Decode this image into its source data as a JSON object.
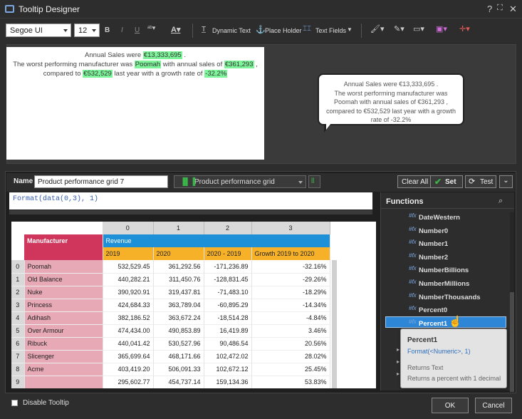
{
  "window": {
    "title": "Tooltip Designer",
    "help": "?",
    "maximize": "⛶",
    "close": "✕"
  },
  "toolbar": {
    "font": "Segoe UI",
    "size": "12",
    "bold": "B",
    "italic": "I",
    "underline": "U",
    "dynamic_text": "Dynamic Text",
    "place_holder": "Place Holder",
    "text_fields": "Text Fields"
  },
  "editor": {
    "line1_pre": "Annual Sales were ",
    "line1_val": "€13,333,695",
    "line1_post": " .",
    "line2_pre": "The worst performing manufacturer was ",
    "line2_name": "Poomah",
    "line2_mid": " with annual sales of ",
    "line2_val": "€361,293",
    "line2_post": " ,",
    "line3_pre": "compared to ",
    "line3_val": "€532,529",
    "line3_mid": " last year with a growth rate of ",
    "line3_rate": "-32.2%"
  },
  "bubble": {
    "line1": "Annual Sales were €13,333,695 .",
    "line2": "The worst performing manufacturer was",
    "line3": "Poomah  with annual sales of €361,293 ,",
    "line4": "compared to €532,529  last year with a growth",
    "line5": "rate of -32.2%"
  },
  "namebar": {
    "label": "Name",
    "name_value": "Product performance grid 7",
    "grid": "Product performance grid",
    "clear_all": "Clear All",
    "set": "Set",
    "test": "Test"
  },
  "formula": "Format(data(0,3), 1)",
  "grid": {
    "col_indices": [
      "0",
      "1",
      "2",
      "3"
    ],
    "manufacturer_header": "Manufacturer",
    "measure_header": "Revenue",
    "sub_headers": [
      "2019",
      "2020",
      "2020 - 2019",
      "Growth 2019 to 2020"
    ],
    "rows": [
      {
        "i": "0",
        "name": "Poomah",
        "v": [
          "532,529.45",
          "361,292.56",
          "-171,236.89",
          "-32.16%"
        ]
      },
      {
        "i": "1",
        "name": "Old Balance",
        "v": [
          "440,282.21",
          "311,450.76",
          "-128,831.45",
          "-29.26%"
        ]
      },
      {
        "i": "2",
        "name": "Nuke",
        "v": [
          "390,920.91",
          "319,437.81",
          "-71,483.10",
          "-18.29%"
        ]
      },
      {
        "i": "3",
        "name": "Princess",
        "v": [
          "424,684.33",
          "363,789.04",
          "-60,895.29",
          "-14.34%"
        ]
      },
      {
        "i": "4",
        "name": "Adihash",
        "v": [
          "382,186.52",
          "363,672.24",
          "-18,514.28",
          "-4.84%"
        ]
      },
      {
        "i": "5",
        "name": "Over Armour",
        "v": [
          "474,434.00",
          "490,853.89",
          "16,419.89",
          "3.46%"
        ]
      },
      {
        "i": "6",
        "name": "Ribuck",
        "v": [
          "440,041.42",
          "530,527.96",
          "90,486.54",
          "20.56%"
        ]
      },
      {
        "i": "7",
        "name": "Slicenger",
        "v": [
          "365,699.64",
          "468,171.66",
          "102,472.02",
          "28.02%"
        ]
      },
      {
        "i": "8",
        "name": "Acme",
        "v": [
          "403,419.20",
          "506,091.33",
          "102,672.12",
          "25.45%"
        ]
      },
      {
        "i": "9",
        "name": "",
        "v": [
          "295,602.77",
          "454,737.14",
          "159,134.36",
          "53.83%"
        ]
      }
    ]
  },
  "functions": {
    "title": "Functions",
    "items": [
      "DateWestern",
      "Number0",
      "Number1",
      "Number2",
      "NumberBillions",
      "NumberMillions",
      "NumberThousands",
      "Percent0",
      "Percent1"
    ],
    "icon_label": "#fx",
    "selected": "Percent1",
    "tooltip": {
      "name": "Percent1",
      "signature": "Format(<Numeric>, 1)",
      "returns_label": "Returns Text",
      "description": "Returns a percent with 1 decimal"
    }
  },
  "footer": {
    "disable_tooltip": "Disable Tooltip",
    "ok": "OK",
    "cancel": "Cancel"
  },
  "colors": {
    "accent": "#2e86d6",
    "set_green": "#3bb54a",
    "highlight": "#7ef59a",
    "manufacturer_pink": "#e8a9b6",
    "header_red": "#d0365b",
    "revenue_blue": "#1e90d8",
    "subheader_orange": "#f7b128"
  }
}
